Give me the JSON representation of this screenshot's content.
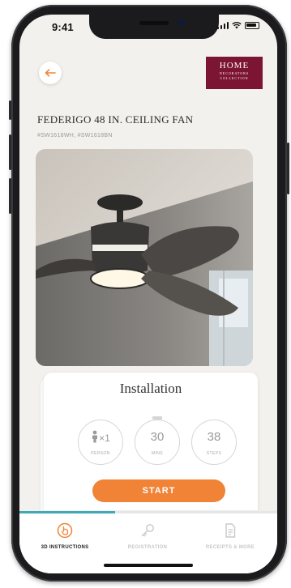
{
  "status_bar": {
    "time": "9:41"
  },
  "header": {
    "back_icon": "arrow-left-icon",
    "brand": {
      "line1": "HOME",
      "line2": "DECORATORS",
      "line3": "COLLECTION",
      "color": "#7c1433"
    }
  },
  "product": {
    "title": "FEDERIGO 48 IN. CEILING FAN",
    "sku": "#SW1618WH, #SW1618BN"
  },
  "installation_card": {
    "title": "Installation",
    "stats": [
      {
        "icon": "person-icon",
        "value": "×1",
        "label": "PERSON"
      },
      {
        "value": "30",
        "label": "MINS"
      },
      {
        "value": "38",
        "label": "STEPS"
      }
    ],
    "start_label": "START",
    "accent": "#f08336"
  },
  "tabbar": {
    "progress": 0.37,
    "progress_color": "#3fa9b5",
    "tabs": [
      {
        "label": "3D INSTRUCTIONS",
        "icon": "hand-pointer-icon",
        "active": true
      },
      {
        "label": "REGISTRATION",
        "icon": "key-icon",
        "active": false
      },
      {
        "label": "RECEIPTS & MORE",
        "icon": "document-icon",
        "active": false
      }
    ]
  }
}
